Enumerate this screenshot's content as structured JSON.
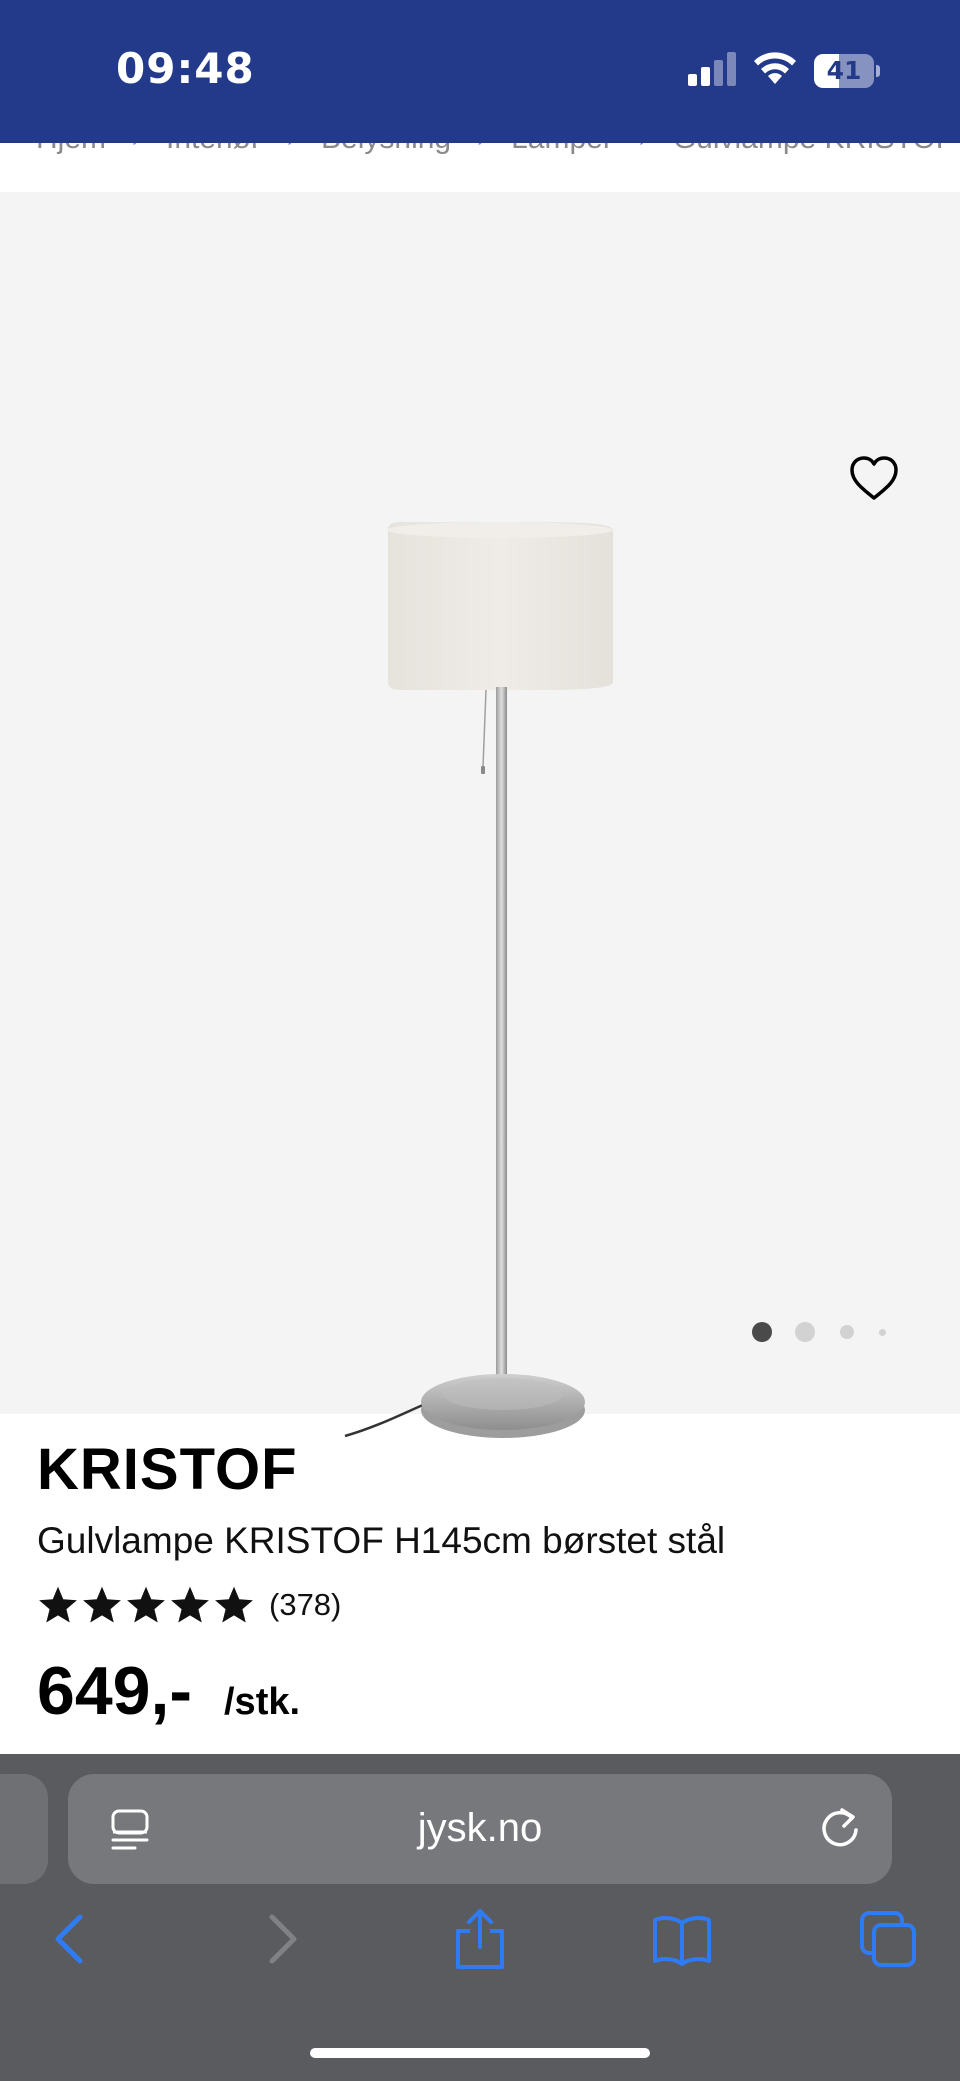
{
  "status_bar": {
    "time": "09:48",
    "battery": "41",
    "battery_level": 0.41,
    "signal_icon": "cellular-signal-icon",
    "wifi_icon": "wifi-icon",
    "battery_icon": "battery-icon",
    "background_color": "#233a8b"
  },
  "breadcrumb": {
    "items": [
      "Hjem",
      "Interiør",
      "Belysning",
      "Lamper",
      "Gulvlampe KRISTOF"
    ]
  },
  "gallery": {
    "favorite_icon": "heart-icon",
    "image": "floor-lamp-image",
    "slide_count": 4,
    "active_slide": 1
  },
  "product": {
    "brand": "KRISTOF",
    "title": "Gulvlampe KRISTOF H145cm børstet stål",
    "rating": 5,
    "rating_count": "(378)",
    "price": "649,-",
    "price_unit": "/stk."
  },
  "browser": {
    "url": "jysk.no",
    "reader_icon": "reader-mode-icon",
    "reload_icon": "reload-icon",
    "toolbar": [
      "back-icon",
      "forward-icon",
      "share-icon",
      "bookmarks-icon",
      "tabs-icon"
    ],
    "accent_color": "#2f7bf6"
  }
}
